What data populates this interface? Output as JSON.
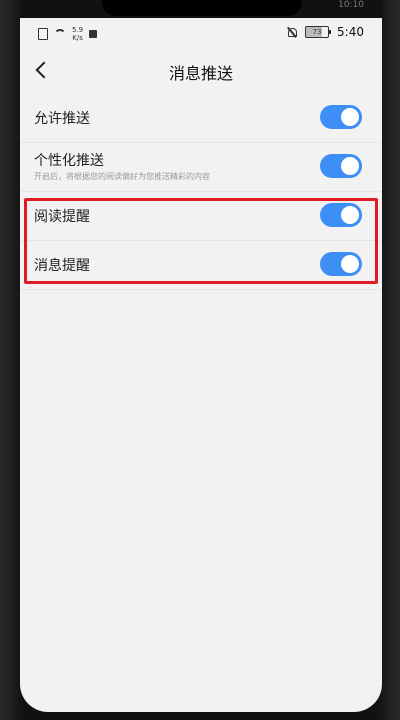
{
  "status_bar": {
    "network_speed_value": "5.9",
    "network_speed_unit": "K/s",
    "battery_level": "73",
    "time": "5:40",
    "ghost_time": "10:10"
  },
  "header": {
    "title": "消息推送"
  },
  "settings": [
    {
      "label": "允许推送",
      "sublabel": "",
      "enabled": true
    },
    {
      "label": "个性化推送",
      "sublabel": "开启后，将根据您的阅读偏好为您推送精彩的内容",
      "enabled": true
    },
    {
      "label": "阅读提醒",
      "sublabel": "",
      "enabled": true
    },
    {
      "label": "消息提醒",
      "sublabel": "",
      "enabled": true
    }
  ],
  "colors": {
    "toggle_on": "#3d8ff5",
    "highlight": "#e01b24",
    "background": "#f2f2f2"
  }
}
